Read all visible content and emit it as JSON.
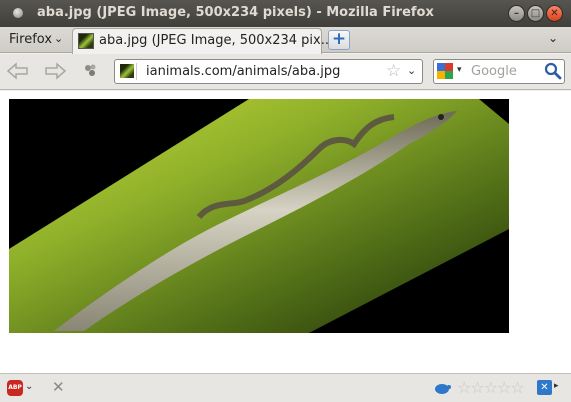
{
  "window": {
    "title": "aba.jpg (JPEG Image, 500x234 pixels) - Mozilla Firefox",
    "buttons": {
      "minimize": "–",
      "maximize": "□",
      "close": "✕"
    }
  },
  "tabbar": {
    "firefox_menu_label": "Firefox",
    "firefox_menu_chevron": "⌄",
    "tabs": [
      {
        "label": "aba.jpg (JPEG Image, 500x234 pix...",
        "active": true
      }
    ],
    "new_tab_label": "+",
    "tab_list_chevron": "⌄"
  },
  "navbar": {
    "url": "ianimals.com/animals/aba.jpg",
    "bookmark_star": "☆",
    "url_dropdown": "⌄",
    "search_placeholder": "Google",
    "search_engine_dropdown": "▾"
  },
  "content": {
    "image_alt": "aba.jpg"
  },
  "statusbar": {
    "abp_label": "ABP",
    "abp_dropdown": "⌄",
    "close_label": "✕",
    "rating_stars": "☆☆☆☆☆",
    "rating_value": 0,
    "end_icon_glyph": "✕",
    "end_arrow": "▸"
  },
  "colors": {
    "titlebar": "#3f3e3a",
    "close_button": "#e0532b",
    "abp_red": "#c8281f",
    "new_tab_blue": "#2d6bc4"
  }
}
